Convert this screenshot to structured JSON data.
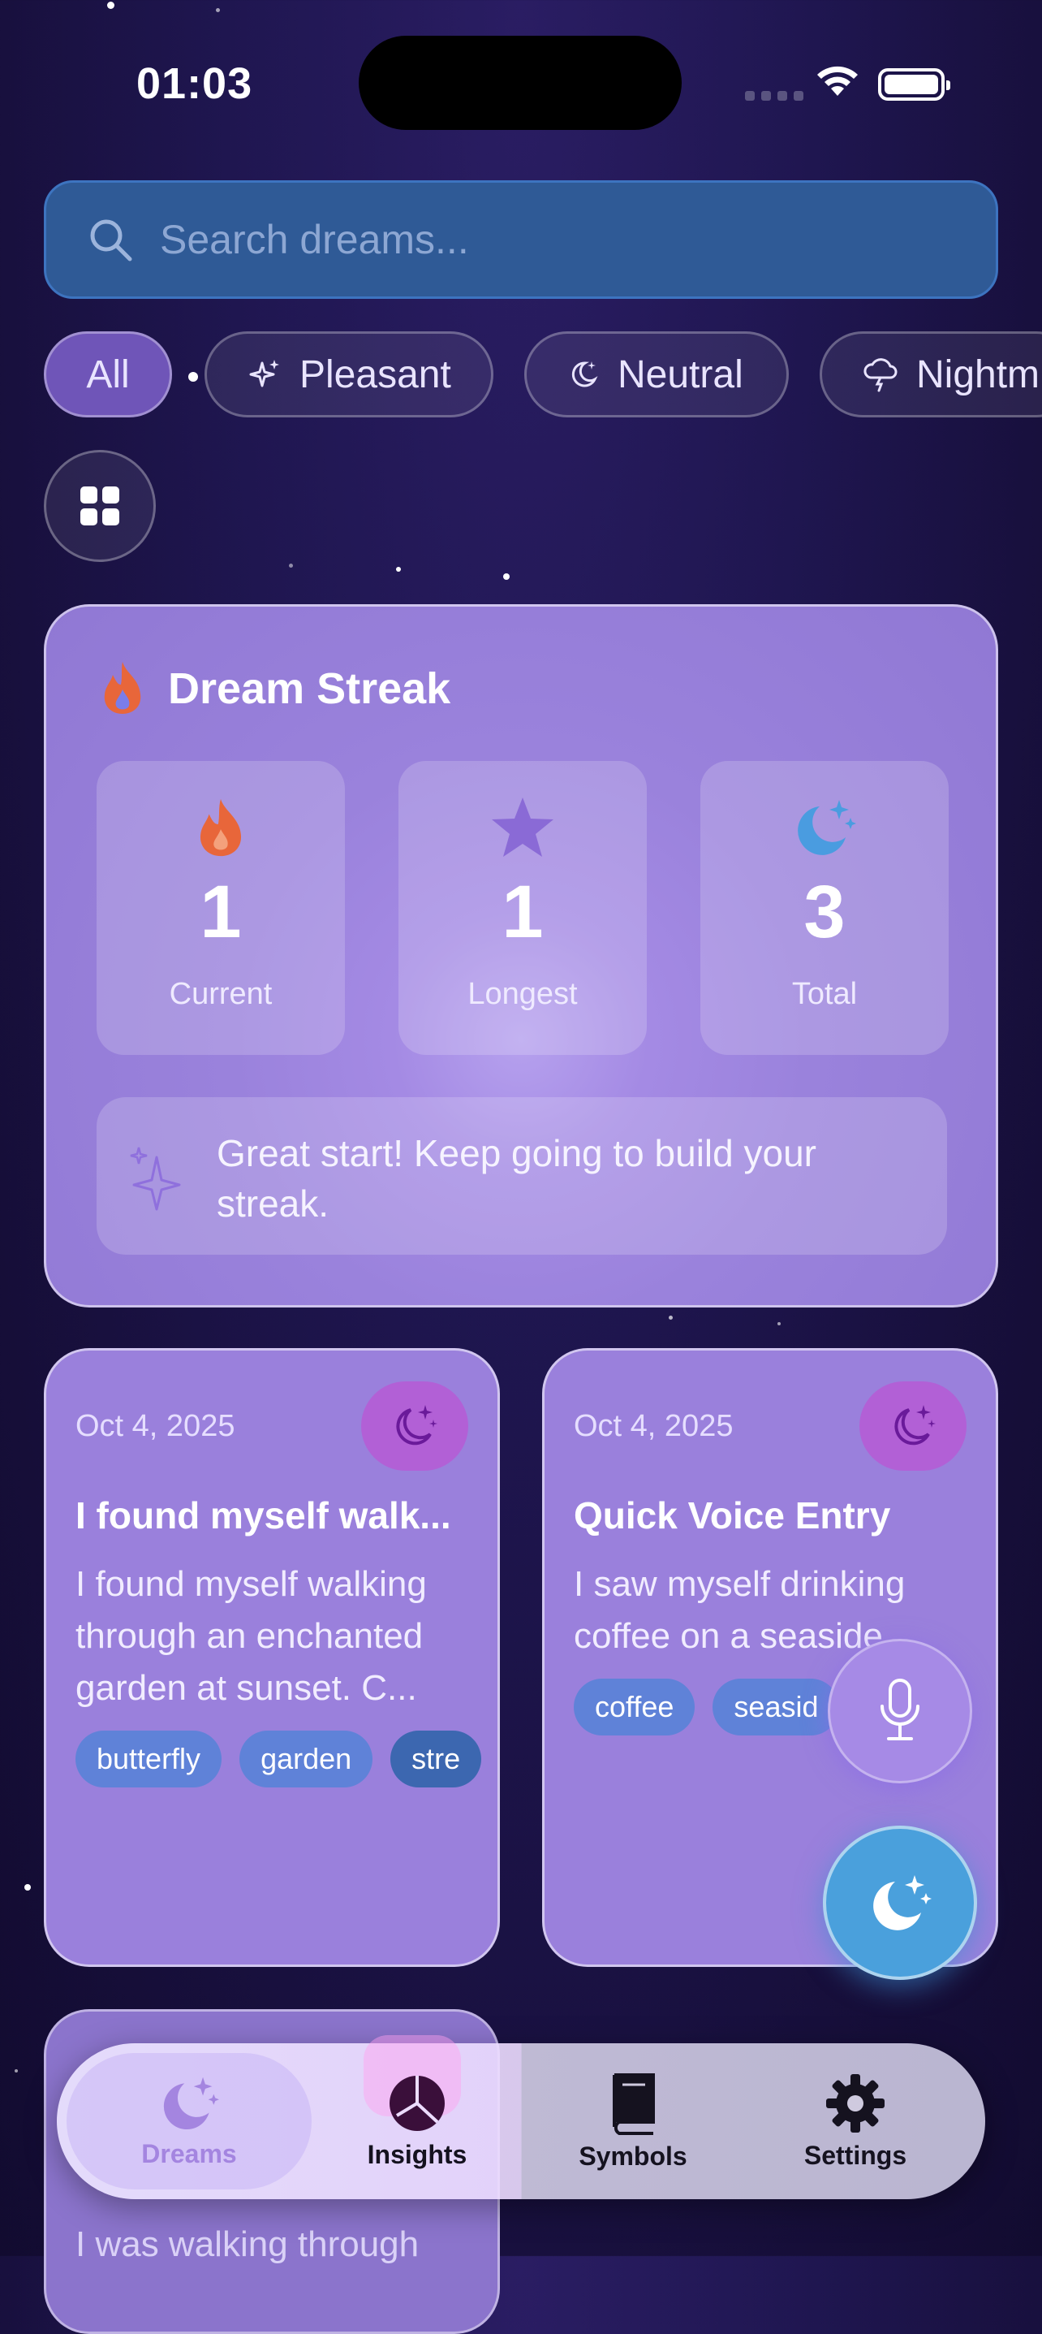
{
  "status_bar": {
    "time": "01:03"
  },
  "search": {
    "placeholder": "Search dreams..."
  },
  "filters": [
    {
      "label": "All",
      "active": true
    },
    {
      "label": "Pleasant",
      "icon": "sparkles-icon"
    },
    {
      "label": "Neutral",
      "icon": "moon-icon"
    },
    {
      "label": "Nightm",
      "icon": "cloud-bolt-icon"
    }
  ],
  "streak": {
    "title": "Dream Streak",
    "stats": [
      {
        "value": "1",
        "label": "Current",
        "icon": "flame-icon"
      },
      {
        "value": "1",
        "label": "Longest",
        "icon": "star-icon"
      },
      {
        "value": "3",
        "label": "Total",
        "icon": "moon-stars-icon"
      }
    ],
    "message": "Great start! Keep going to build your streak."
  },
  "dreams": [
    {
      "date": "Oct 4, 2025",
      "title": "I found myself walk...",
      "excerpt": "I found myself walking through an enchanted garden at sunset. C...",
      "tags": [
        "butterfly",
        "garden",
        "stre"
      ]
    },
    {
      "date": "Oct 4, 2025",
      "title": "Quick Voice Entry",
      "excerpt": "I saw myself drinking coffee on a seaside",
      "tags": [
        "coffee",
        "seasid"
      ]
    },
    {
      "excerpt": "I was walking through"
    }
  ],
  "tabbar": {
    "tabs": [
      {
        "label": "Dreams",
        "icon": "moon-stars-icon",
        "active": true
      },
      {
        "label": "Insights",
        "icon": "pie-chart-icon"
      },
      {
        "label": "Symbols",
        "icon": "book-icon"
      },
      {
        "label": "Settings",
        "icon": "gear-icon"
      }
    ]
  },
  "colors": {
    "accent": "#9b84df",
    "search_bg": "#2f5a96",
    "tag": "#5f82d8",
    "fab": "#4aa0dc",
    "mood_badge": "#b260d6"
  }
}
